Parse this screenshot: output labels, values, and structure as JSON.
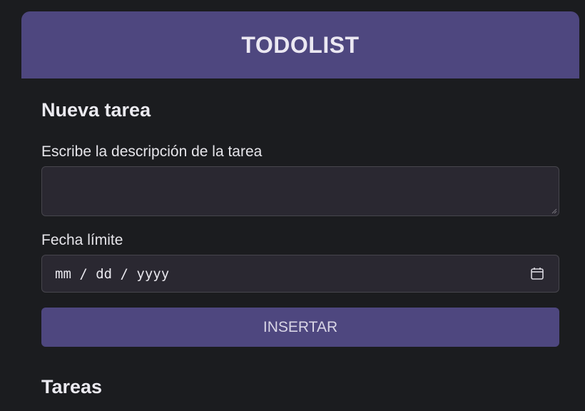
{
  "header": {
    "title": "TODOLIST"
  },
  "form": {
    "section_title": "Nueva tarea",
    "description_label": "Escribe la descripción de la tarea",
    "description_value": "",
    "date_label": "Fecha límite",
    "date_placeholder": "mm / dd / yyyy",
    "submit_label": "INSERTAR"
  },
  "tasks": {
    "section_title": "Tareas"
  },
  "colors": {
    "accent": "#4e477f",
    "background": "#1b1c1f",
    "input_background": "#2a2831"
  },
  "icons": {
    "date_picker": "calendar-icon",
    "textarea_resize": "resize-grip-icon"
  }
}
